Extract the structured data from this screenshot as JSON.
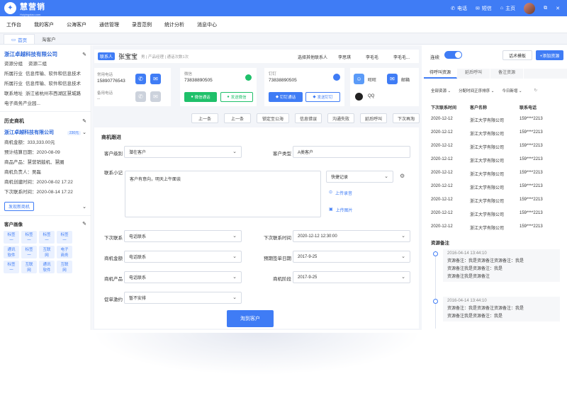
{
  "app": {
    "name": "慧营销",
    "sub": "Huiyingxiao.com",
    "logo_glyph": "✦"
  },
  "topbar": {
    "phone": "电话",
    "message": "短信",
    "home": "主页"
  },
  "menu": [
    "工作台",
    "我的客户",
    "公海客户",
    "通信管理",
    "录音范例",
    "统计分析",
    "消息中心"
  ],
  "tabs": [
    {
      "label": "首页",
      "icon": "monitor-icon"
    },
    {
      "label": "淘客户"
    }
  ],
  "left": {
    "company": "浙江卓越科技有限公司",
    "rows": [
      {
        "label": "资源分组",
        "value": "资源二组"
      },
      {
        "label": "所属行业",
        "value": "信息传输、软件和信息技术"
      },
      {
        "label": "所属行业",
        "value": "信息传输、软件和信息技术"
      },
      {
        "label": "联系地址",
        "value": "浙江省杭州市西湖区慧城路"
      },
      {
        "label": "电子商务产业园...",
        "value": ""
      }
    ],
    "history_title": "历史商机",
    "history_company": "浙江卓越科技有限公司",
    "history_badge": "230元",
    "history_rows": [
      "商机金额：333,333.00元",
      "预计结算日期：2020-08-09",
      "商品产品：慧营销鼓机、慧圈",
      "商机负责人：吴磊",
      "商机创建时间：2020-08-02 17:22",
      "下次联系时间：2020-08-14 17:22"
    ],
    "new_opportunity": "发现新商机",
    "portrait_title": "客户画像",
    "tags": [
      "标签一",
      "标签一",
      "标签一",
      "标签一",
      "通讯软件",
      "标签一",
      "互联网",
      "电子商务",
      "标签一",
      "互联网",
      "通讯软件",
      "互联网"
    ]
  },
  "contact": {
    "role_tag": "联系人",
    "name": "张宝宝",
    "meta": "男 | 产品经理 | 通话次数1次",
    "choose_other": "选择其他联系人",
    "others": [
      "李思琪",
      "李毛毛",
      "李毛毛..."
    ],
    "phone_label": "常用电话",
    "phone_value": "15890776543",
    "backup_label": "备用电话",
    "backup_value": "--",
    "wechat_label": "微信",
    "wechat_value": "73838890505",
    "wechat_call": "微信通话",
    "wechat_send": "发送微信",
    "dingtalk_label": "钉钉",
    "dingtalk_value": "73838890505",
    "dingtalk_call": "钉钉通话",
    "dingtalk_send": "发送钉钉",
    "wangwang": "旺旺",
    "email": "邮箱",
    "qq": "QQ"
  },
  "actions": [
    "上一条",
    "上一条",
    "锁定至公海",
    "信息错误",
    "沟通失败",
    "延后呼叫",
    "下次再淘"
  ],
  "form": {
    "section": "商机跟进",
    "level_label": "客户级别",
    "level_value": "潜在客户",
    "type_label": "客户类型",
    "type_value": "A类客户",
    "note_label": "联系小记",
    "note_value": "客户有意向，明天上午面谈",
    "quick_record": "快捷记录",
    "upload_audio": "上传录音",
    "upload_image": "上传图片",
    "next_contact_label": "下次联系",
    "next_contact_value": "电话联系",
    "next_time_label": "下次联系时间",
    "next_time_value": "2020-12-12 12:30:00",
    "amount_label": "商机金额",
    "amount_value": "电话联系",
    "sign_date_label": "预期签单日期",
    "sign_date_value": "2017-9-25",
    "product_label": "商机产品",
    "product_value": "电话联系",
    "stage_label": "商机阶段",
    "stage_value": "2017-9-25",
    "promo_label": "促单激约",
    "promo_value": "暂不安排",
    "submit": "淘到客户"
  },
  "right": {
    "connect": "连续",
    "script_template": "话术模板",
    "add_resource": "+添加资源",
    "tabs": [
      "待呼叫资源",
      "延后呼叫",
      "备注资源"
    ],
    "filters": [
      "全部资源",
      "分配时间正序排序",
      "今日新增"
    ],
    "headers": [
      "下次联系时间",
      "客户名称",
      "联系电话"
    ],
    "rows": [
      [
        "2020-12-12",
        "浙江大学有限公司",
        "159****2213"
      ],
      [
        "2020-12-12",
        "浙江大学有限公司",
        "159****2213"
      ],
      [
        "2020-12-12",
        "浙江大学有限公司",
        "159****2213"
      ],
      [
        "2020-12-12",
        "浙江大学有限公司",
        "159****2213"
      ],
      [
        "2020-12-12",
        "浙江大学有限公司",
        "159****2213"
      ],
      [
        "2020-12-12",
        "浙江大学有限公司",
        "159****2213"
      ],
      [
        "2020-12-12",
        "浙江大学有限公司",
        "159****2213"
      ],
      [
        "2020-12-12",
        "浙江大学有限公司",
        "159****2213"
      ],
      [
        "2020-12-12",
        "浙江大学有限公司",
        "159****2213"
      ]
    ],
    "remarks_title": "资源备注",
    "remarks": [
      {
        "time": "2016-04-14 13:44:10",
        "lines": [
          "资源备注：我是资源备注资源备注：我是",
          "资源备注我是资源备注：我是",
          "资源备注我是资源备注"
        ]
      },
      {
        "time": "2016-04-14 13:44:10",
        "lines": [
          "资源备注：我是资源备注资源备注：我是",
          "资源备注我是资源备注：我是"
        ]
      }
    ]
  },
  "colors": {
    "brand": "#3f7cf5",
    "green": "#1fc06a"
  }
}
